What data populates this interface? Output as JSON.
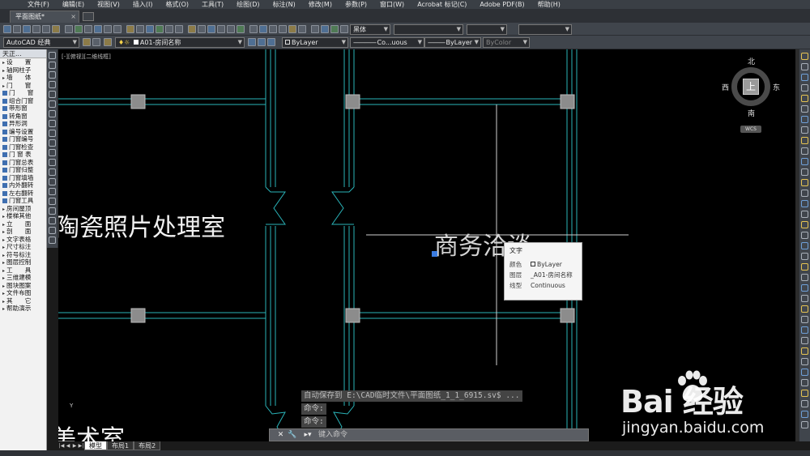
{
  "menubar": [
    "文件(F)",
    "编辑(E)",
    "视图(V)",
    "插入(I)",
    "格式(O)",
    "工具(T)",
    "绘图(D)",
    "标注(N)",
    "修改(M)",
    "参数(P)",
    "窗口(W)",
    "Acrobat 标记(C)",
    "Adobe PDF(B)",
    "帮助(H)"
  ],
  "doc_tab": {
    "label": "平面图纸*",
    "close": "×"
  },
  "toolbar": {
    "workspace": "AutoCAD 经典",
    "layer": "A01-房间名称",
    "color": "ByLayer",
    "font": "黑体",
    "linetype": "Co...uous",
    "lineweight": "ByLayer",
    "plotstyle": "ByColor"
  },
  "left_panel": {
    "title": "天正...",
    "items": [
      "设　　置",
      "轴网柱子",
      "墙　　体",
      "门　　窗",
      "门　　窗",
      "组合门窗",
      "带形窗",
      "转角窗",
      "异形洞",
      "编号设置",
      "门窗编号",
      "门窗检查",
      "门 窗 表",
      "门窗总表",
      "门窗归整",
      "门窗填墙",
      "内外翻转",
      "左右翻转",
      "门窗工具",
      "房间屋顶",
      "楼梯其他",
      "立　　面",
      "剖　　面",
      "文字表格",
      "尺寸标注",
      "符号标注",
      "图层控制",
      "工　　具",
      "三维建模",
      "图块图案",
      "文件布图",
      "其　　它",
      "帮助演示"
    ]
  },
  "canvas": {
    "viewport_label": "[-][俯视][二维线框]",
    "room_labels": [
      "陶瓷照片处理室",
      "美术室",
      "商务洽谈"
    ]
  },
  "tooltip": {
    "title": "文字",
    "rows": [
      {
        "key": "颜色",
        "value": "ByLayer"
      },
      {
        "key": "图层",
        "value": "_A01-房间名称"
      },
      {
        "key": "线型",
        "value": "Continuous"
      }
    ]
  },
  "viewcube": {
    "north": "北",
    "south": "南",
    "east": "东",
    "west": "西",
    "face": "上",
    "wcs": "WCS"
  },
  "command": {
    "history": [
      "自动保存到 E:\\CAD临时文件\\平面图纸_1_1_6915.sv$ ...",
      "命令:",
      "命令:"
    ],
    "placeholder": "键入命令"
  },
  "layout_tabs": [
    "模型",
    "布局1",
    "布局2"
  ],
  "watermark": {
    "logo": "Bai  经验",
    "url": "jingyan.baidu.com"
  }
}
